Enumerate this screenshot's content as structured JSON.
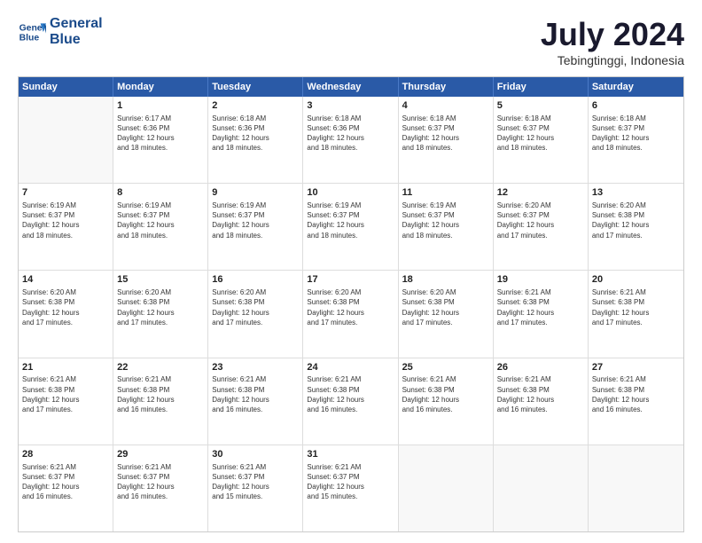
{
  "logo": {
    "line1": "General",
    "line2": "Blue"
  },
  "title": "July 2024",
  "subtitle": "Tebingtinggi, Indonesia",
  "days": [
    "Sunday",
    "Monday",
    "Tuesday",
    "Wednesday",
    "Thursday",
    "Friday",
    "Saturday"
  ],
  "rows": [
    [
      {
        "day": "",
        "info": ""
      },
      {
        "day": "1",
        "info": "Sunrise: 6:17 AM\nSunset: 6:36 PM\nDaylight: 12 hours\nand 18 minutes."
      },
      {
        "day": "2",
        "info": "Sunrise: 6:18 AM\nSunset: 6:36 PM\nDaylight: 12 hours\nand 18 minutes."
      },
      {
        "day": "3",
        "info": "Sunrise: 6:18 AM\nSunset: 6:36 PM\nDaylight: 12 hours\nand 18 minutes."
      },
      {
        "day": "4",
        "info": "Sunrise: 6:18 AM\nSunset: 6:37 PM\nDaylight: 12 hours\nand 18 minutes."
      },
      {
        "day": "5",
        "info": "Sunrise: 6:18 AM\nSunset: 6:37 PM\nDaylight: 12 hours\nand 18 minutes."
      },
      {
        "day": "6",
        "info": "Sunrise: 6:18 AM\nSunset: 6:37 PM\nDaylight: 12 hours\nand 18 minutes."
      }
    ],
    [
      {
        "day": "7",
        "info": "Sunrise: 6:19 AM\nSunset: 6:37 PM\nDaylight: 12 hours\nand 18 minutes."
      },
      {
        "day": "8",
        "info": "Sunrise: 6:19 AM\nSunset: 6:37 PM\nDaylight: 12 hours\nand 18 minutes."
      },
      {
        "day": "9",
        "info": "Sunrise: 6:19 AM\nSunset: 6:37 PM\nDaylight: 12 hours\nand 18 minutes."
      },
      {
        "day": "10",
        "info": "Sunrise: 6:19 AM\nSunset: 6:37 PM\nDaylight: 12 hours\nand 18 minutes."
      },
      {
        "day": "11",
        "info": "Sunrise: 6:19 AM\nSunset: 6:37 PM\nDaylight: 12 hours\nand 18 minutes."
      },
      {
        "day": "12",
        "info": "Sunrise: 6:20 AM\nSunset: 6:37 PM\nDaylight: 12 hours\nand 17 minutes."
      },
      {
        "day": "13",
        "info": "Sunrise: 6:20 AM\nSunset: 6:38 PM\nDaylight: 12 hours\nand 17 minutes."
      }
    ],
    [
      {
        "day": "14",
        "info": "Sunrise: 6:20 AM\nSunset: 6:38 PM\nDaylight: 12 hours\nand 17 minutes."
      },
      {
        "day": "15",
        "info": "Sunrise: 6:20 AM\nSunset: 6:38 PM\nDaylight: 12 hours\nand 17 minutes."
      },
      {
        "day": "16",
        "info": "Sunrise: 6:20 AM\nSunset: 6:38 PM\nDaylight: 12 hours\nand 17 minutes."
      },
      {
        "day": "17",
        "info": "Sunrise: 6:20 AM\nSunset: 6:38 PM\nDaylight: 12 hours\nand 17 minutes."
      },
      {
        "day": "18",
        "info": "Sunrise: 6:20 AM\nSunset: 6:38 PM\nDaylight: 12 hours\nand 17 minutes."
      },
      {
        "day": "19",
        "info": "Sunrise: 6:21 AM\nSunset: 6:38 PM\nDaylight: 12 hours\nand 17 minutes."
      },
      {
        "day": "20",
        "info": "Sunrise: 6:21 AM\nSunset: 6:38 PM\nDaylight: 12 hours\nand 17 minutes."
      }
    ],
    [
      {
        "day": "21",
        "info": "Sunrise: 6:21 AM\nSunset: 6:38 PM\nDaylight: 12 hours\nand 17 minutes."
      },
      {
        "day": "22",
        "info": "Sunrise: 6:21 AM\nSunset: 6:38 PM\nDaylight: 12 hours\nand 16 minutes."
      },
      {
        "day": "23",
        "info": "Sunrise: 6:21 AM\nSunset: 6:38 PM\nDaylight: 12 hours\nand 16 minutes."
      },
      {
        "day": "24",
        "info": "Sunrise: 6:21 AM\nSunset: 6:38 PM\nDaylight: 12 hours\nand 16 minutes."
      },
      {
        "day": "25",
        "info": "Sunrise: 6:21 AM\nSunset: 6:38 PM\nDaylight: 12 hours\nand 16 minutes."
      },
      {
        "day": "26",
        "info": "Sunrise: 6:21 AM\nSunset: 6:38 PM\nDaylight: 12 hours\nand 16 minutes."
      },
      {
        "day": "27",
        "info": "Sunrise: 6:21 AM\nSunset: 6:38 PM\nDaylight: 12 hours\nand 16 minutes."
      }
    ],
    [
      {
        "day": "28",
        "info": "Sunrise: 6:21 AM\nSunset: 6:37 PM\nDaylight: 12 hours\nand 16 minutes."
      },
      {
        "day": "29",
        "info": "Sunrise: 6:21 AM\nSunset: 6:37 PM\nDaylight: 12 hours\nand 16 minutes."
      },
      {
        "day": "30",
        "info": "Sunrise: 6:21 AM\nSunset: 6:37 PM\nDaylight: 12 hours\nand 15 minutes."
      },
      {
        "day": "31",
        "info": "Sunrise: 6:21 AM\nSunset: 6:37 PM\nDaylight: 12 hours\nand 15 minutes."
      },
      {
        "day": "",
        "info": ""
      },
      {
        "day": "",
        "info": ""
      },
      {
        "day": "",
        "info": ""
      }
    ]
  ]
}
